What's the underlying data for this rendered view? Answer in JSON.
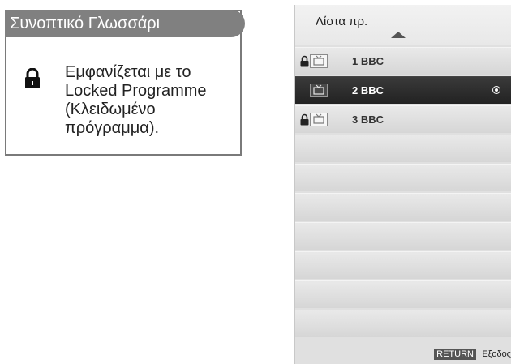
{
  "glossary": {
    "title": "Συνοπτικό Γλωσσάρι",
    "icon": "lock-icon",
    "description": "Εμφανίζεται με το Locked Programme (Κλειδωμένο πρόγραμμα)."
  },
  "channel_list": {
    "title": "Λίστα πρ.",
    "rows": [
      {
        "name": "1 BBC",
        "locked": true,
        "selected": false
      },
      {
        "name": "2 BBC",
        "locked": false,
        "selected": true
      },
      {
        "name": "3 BBC",
        "locked": true,
        "selected": false
      },
      {
        "name": "",
        "locked": false,
        "selected": false
      },
      {
        "name": "",
        "locked": false,
        "selected": false
      },
      {
        "name": "",
        "locked": false,
        "selected": false
      },
      {
        "name": "",
        "locked": false,
        "selected": false
      },
      {
        "name": "",
        "locked": false,
        "selected": false
      },
      {
        "name": "",
        "locked": false,
        "selected": false
      },
      {
        "name": "",
        "locked": false,
        "selected": false
      }
    ],
    "footer": {
      "return_key": "RETURN",
      "exit_label": "Εξοδος"
    }
  },
  "colors": {
    "header_gray": "#808080",
    "selected_row": "#2a2a2a",
    "panel_bg": "#e0e0e0"
  }
}
